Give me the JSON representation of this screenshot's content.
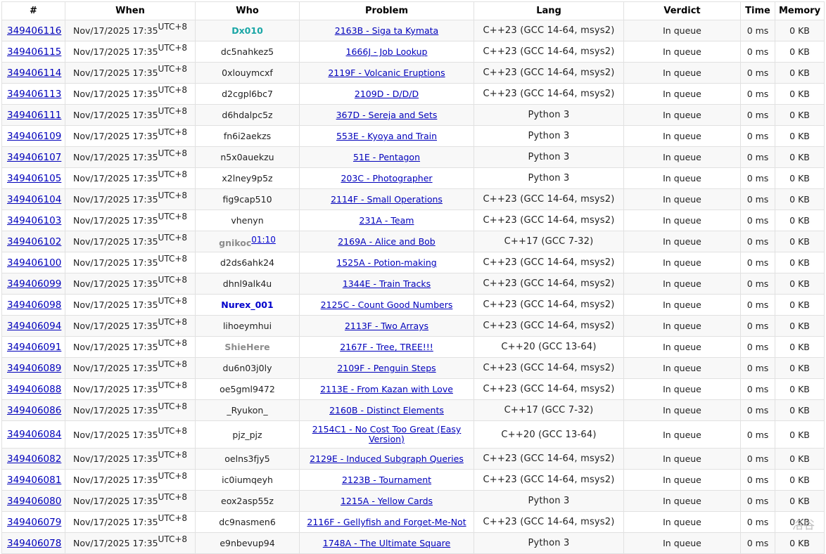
{
  "columns": [
    "#",
    "When",
    "Who",
    "Problem",
    "Lang",
    "Verdict",
    "Time",
    "Memory"
  ],
  "tz": "UTC+8",
  "rows": [
    {
      "id": "349406116",
      "when": "Nov/17/2025 17:35",
      "who": "Dx010",
      "who_color": "#1aa6a6",
      "who_bold": true,
      "problem": "2163B - Siga ta Kymata",
      "lang": "C++23 (GCC 14-64, msys2)",
      "verdict": "In queue",
      "time": "0 ms",
      "mem": "0 KB"
    },
    {
      "id": "349406115",
      "when": "Nov/17/2025 17:35",
      "who": "dc5nahkez5",
      "problem": "1666J - Job Lookup",
      "lang": "C++23 (GCC 14-64, msys2)",
      "verdict": "In queue",
      "time": "0 ms",
      "mem": "0 KB"
    },
    {
      "id": "349406114",
      "when": "Nov/17/2025 17:35",
      "who": "0xlouymcxf",
      "problem": "2119F - Volcanic Eruptions",
      "lang": "C++23 (GCC 14-64, msys2)",
      "verdict": "In queue",
      "time": "0 ms",
      "mem": "0 KB"
    },
    {
      "id": "349406113",
      "when": "Nov/17/2025 17:35",
      "who": "d2cgpl6bc7",
      "problem": "2109D - D/D/D",
      "lang": "C++23 (GCC 14-64, msys2)",
      "verdict": "In queue",
      "time": "0 ms",
      "mem": "0 KB"
    },
    {
      "id": "349406111",
      "when": "Nov/17/2025 17:35",
      "who": "d6hdalpc5z",
      "problem": "367D - Sereja and Sets",
      "lang": "Python 3",
      "verdict": "In queue",
      "time": "0 ms",
      "mem": "0 KB"
    },
    {
      "id": "349406109",
      "when": "Nov/17/2025 17:35",
      "who": "fn6i2aekzs",
      "problem": "553E - Kyoya and Train",
      "lang": "Python 3",
      "verdict": "In queue",
      "time": "0 ms",
      "mem": "0 KB"
    },
    {
      "id": "349406107",
      "when": "Nov/17/2025 17:35",
      "who": "n5x0auekzu",
      "problem": "51E - Pentagon",
      "lang": "Python 3",
      "verdict": "In queue",
      "time": "0 ms",
      "mem": "0 KB"
    },
    {
      "id": "349406105",
      "when": "Nov/17/2025 17:35",
      "who": "x2lney9p5z",
      "problem": "203C - Photographer",
      "lang": "Python 3",
      "verdict": "In queue",
      "time": "0 ms",
      "mem": "0 KB"
    },
    {
      "id": "349406104",
      "when": "Nov/17/2025 17:35",
      "who": "fig9cap510",
      "problem": "2114F - Small Operations",
      "lang": "C++23 (GCC 14-64, msys2)",
      "verdict": "In queue",
      "time": "0 ms",
      "mem": "0 KB"
    },
    {
      "id": "349406103",
      "when": "Nov/17/2025 17:35",
      "who": "vhenyn",
      "problem": "231A - Team",
      "lang": "C++23 (GCC 14-64, msys2)",
      "verdict": "In queue",
      "time": "0 ms",
      "mem": "0 KB"
    },
    {
      "id": "349406102",
      "when": "Nov/17/2025 17:35",
      "who": "gnikoc",
      "who_color": "#8c8c8c",
      "who_bold": true,
      "who_suffix": "01:10",
      "problem": "2169A - Alice and Bob",
      "lang": "C++17 (GCC 7-32)",
      "verdict": "In queue",
      "time": "0 ms",
      "mem": "0 KB"
    },
    {
      "id": "349406100",
      "when": "Nov/17/2025 17:35",
      "who": "d2ds6ahk24",
      "problem": "1525A - Potion-making",
      "lang": "C++23 (GCC 14-64, msys2)",
      "verdict": "In queue",
      "time": "0 ms",
      "mem": "0 KB"
    },
    {
      "id": "349406099",
      "when": "Nov/17/2025 17:35",
      "who": "dhnl9alk4u",
      "problem": "1344E - Train Tracks",
      "lang": "C++23 (GCC 14-64, msys2)",
      "verdict": "In queue",
      "time": "0 ms",
      "mem": "0 KB"
    },
    {
      "id": "349406098",
      "when": "Nov/17/2025 17:35",
      "who": "Nurex_001",
      "who_color": "#0000cc",
      "who_bold": true,
      "problem": "2125C - Count Good Numbers",
      "lang": "C++23 (GCC 14-64, msys2)",
      "verdict": "In queue",
      "time": "0 ms",
      "mem": "0 KB"
    },
    {
      "id": "349406094",
      "when": "Nov/17/2025 17:35",
      "who": "lihoeymhui",
      "problem": "2113F - Two Arrays",
      "lang": "C++23 (GCC 14-64, msys2)",
      "verdict": "In queue",
      "time": "0 ms",
      "mem": "0 KB"
    },
    {
      "id": "349406091",
      "when": "Nov/17/2025 17:35",
      "who": "ShieHere",
      "who_color": "#8c8c8c",
      "who_bold": true,
      "problem": "2167F - Tree, TREE!!!",
      "lang": "C++20 (GCC 13-64)",
      "verdict": "In queue",
      "time": "0 ms",
      "mem": "0 KB"
    },
    {
      "id": "349406089",
      "when": "Nov/17/2025 17:35",
      "who": "du6n03j0ly",
      "problem": "2109F - Penguin Steps",
      "lang": "C++23 (GCC 14-64, msys2)",
      "verdict": "In queue",
      "time": "0 ms",
      "mem": "0 KB"
    },
    {
      "id": "349406088",
      "when": "Nov/17/2025 17:35",
      "who": "oe5gml9472",
      "problem": "2113E - From Kazan with Love",
      "lang": "C++23 (GCC 14-64, msys2)",
      "verdict": "In queue",
      "time": "0 ms",
      "mem": "0 KB"
    },
    {
      "id": "349406086",
      "when": "Nov/17/2025 17:35",
      "who": "_Ryukon_",
      "problem": "2160B - Distinct Elements",
      "lang": "C++17 (GCC 7-32)",
      "verdict": "In queue",
      "time": "0 ms",
      "mem": "0 KB"
    },
    {
      "id": "349406084",
      "when": "Nov/17/2025 17:35",
      "who": "pjz_pjz",
      "problem": "2154C1 - No Cost Too Great (Easy Version)",
      "lang": "C++20 (GCC 13-64)",
      "verdict": "In queue",
      "time": "0 ms",
      "mem": "0 KB",
      "tall": true
    },
    {
      "id": "349406082",
      "when": "Nov/17/2025 17:35",
      "who": "oelns3fjy5",
      "problem": "2129E - Induced Subgraph Queries",
      "lang": "C++23 (GCC 14-64, msys2)",
      "verdict": "In queue",
      "time": "0 ms",
      "mem": "0 KB"
    },
    {
      "id": "349406081",
      "when": "Nov/17/2025 17:35",
      "who": "ic0iumqeyh",
      "problem": "2123B - Tournament",
      "lang": "C++23 (GCC 14-64, msys2)",
      "verdict": "In queue",
      "time": "0 ms",
      "mem": "0 KB"
    },
    {
      "id": "349406080",
      "when": "Nov/17/2025 17:35",
      "who": "eox2asp55z",
      "problem": "1215A - Yellow Cards",
      "lang": "Python 3",
      "verdict": "In queue",
      "time": "0 ms",
      "mem": "0 KB"
    },
    {
      "id": "349406079",
      "when": "Nov/17/2025 17:35",
      "who": "dc9nasmen6",
      "problem": "2116F - Gellyfish and Forget-Me-Not",
      "lang": "C++23 (GCC 14-64, msys2)",
      "verdict": "In queue",
      "time": "0 ms",
      "mem": "0 KB"
    },
    {
      "id": "349406078",
      "when": "Nov/17/2025 17:35",
      "who": "e9nbevup94",
      "problem": "1748A - The Ultimate Square",
      "lang": "Python 3",
      "verdict": "In queue",
      "time": "0 ms",
      "mem": "0 KB"
    }
  ],
  "watermark": "洛谷"
}
